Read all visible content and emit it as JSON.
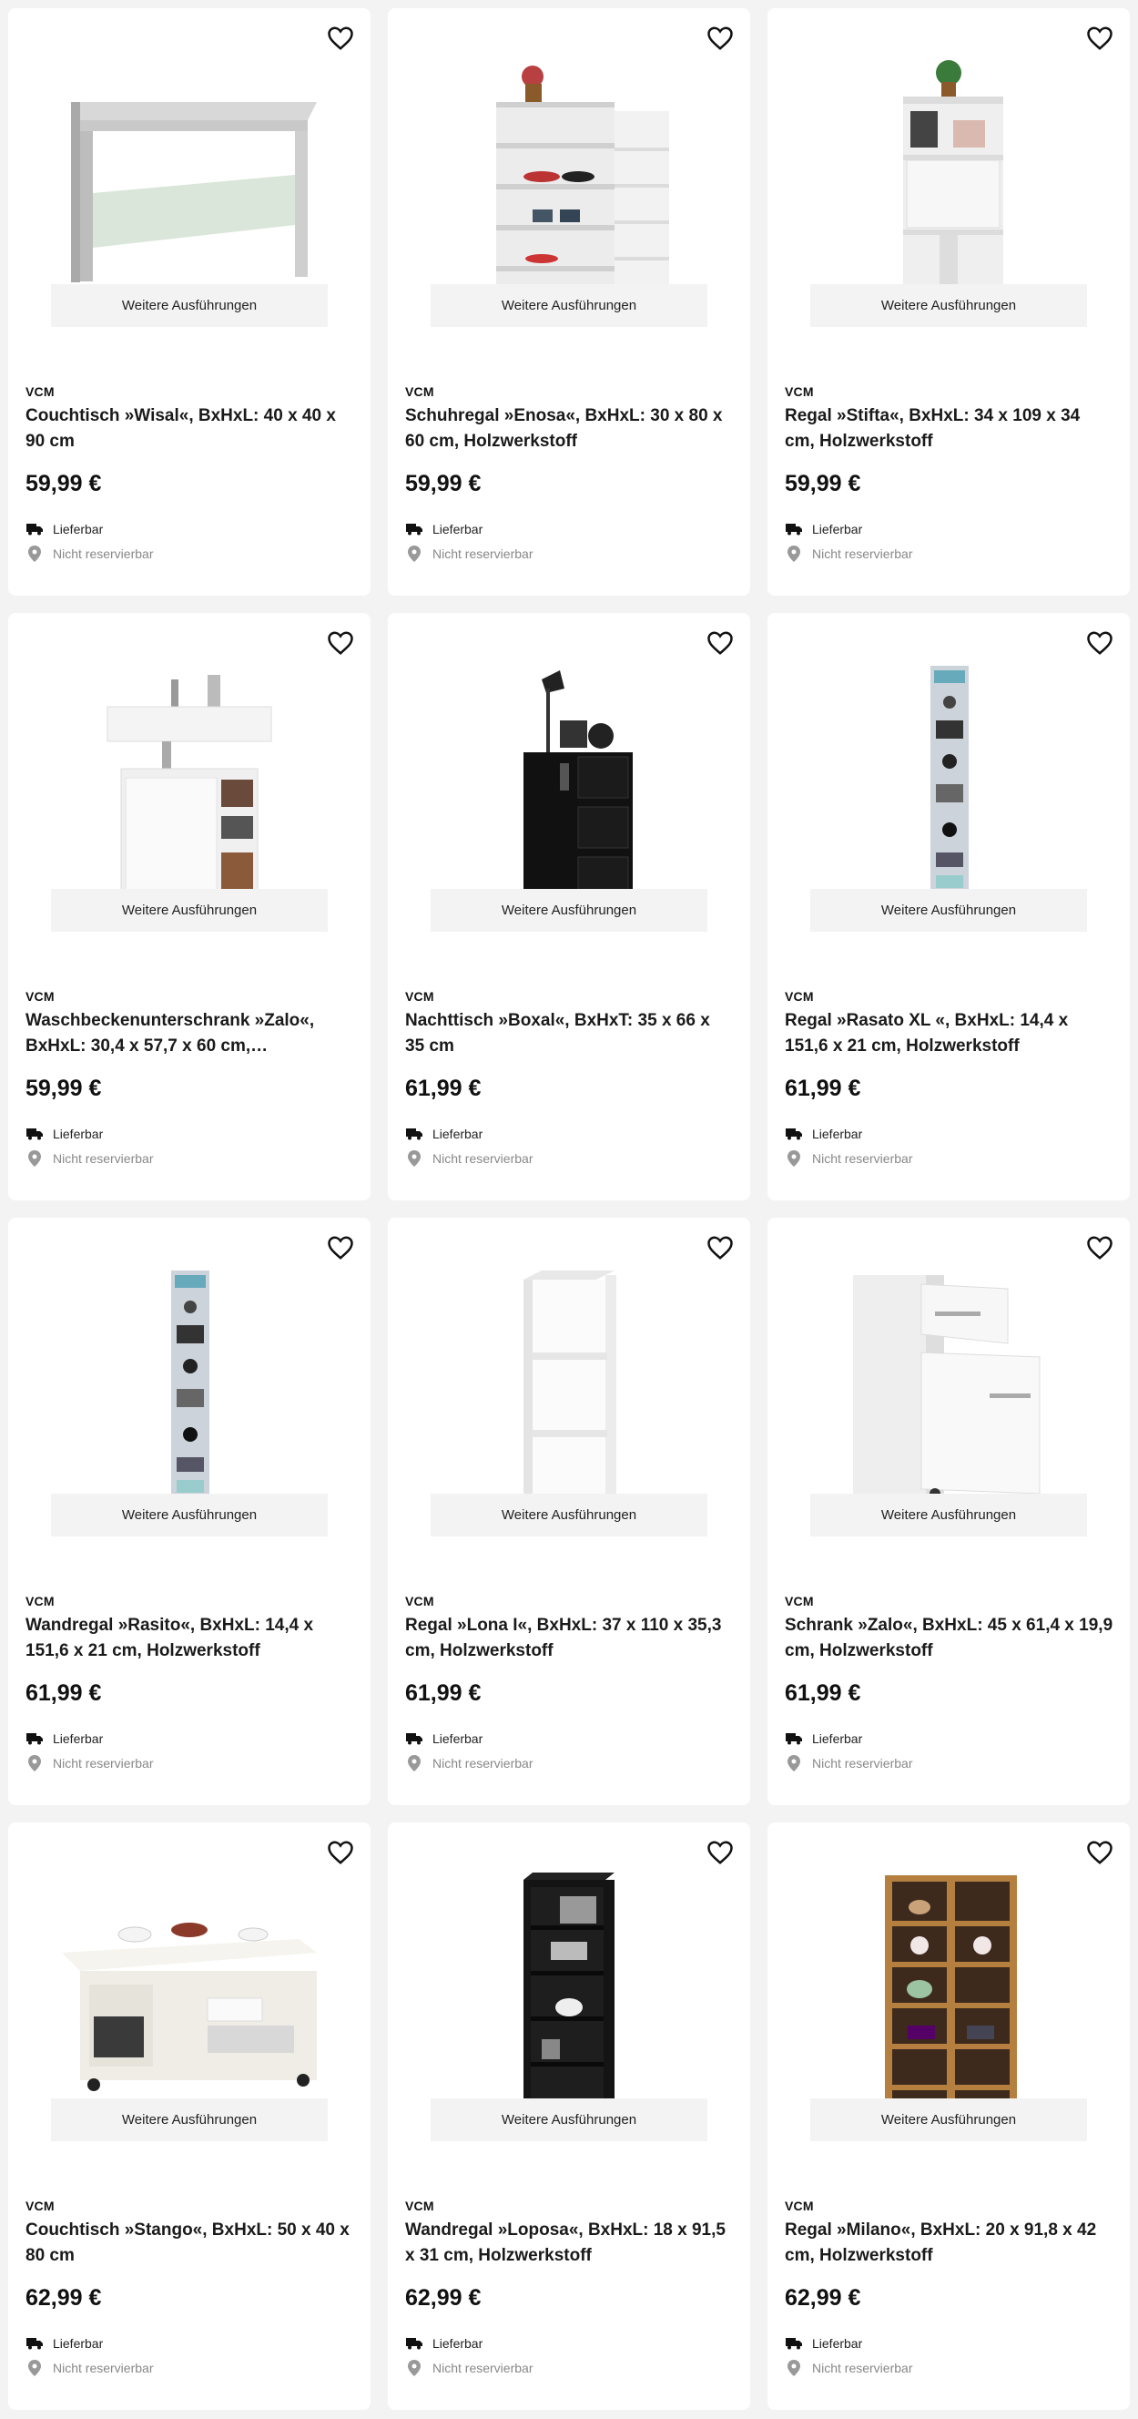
{
  "ui": {
    "more_label": "Weitere Ausführungen",
    "delivery_label": "Lieferbar",
    "reserve_label": "Nicht reservierbar",
    "favorite_icon": "heart-outline-icon",
    "delivery_icon": "truck-icon",
    "reserve_icon": "location-pin-icon"
  },
  "products": [
    {
      "brand": "VCM",
      "title": "Couchtisch »Wisal«, BxHxL: 40 x 40 x 90 cm",
      "price": "59,99 €"
    },
    {
      "brand": "VCM",
      "title": "Schuhregal »Enosa«, BxHxL: 30 x 80 x 60 cm, Holzwerkstoff",
      "price": "59,99 €"
    },
    {
      "brand": "VCM",
      "title": "Regal »Stifta«, BxHxL: 34 x 109 x 34 cm, Holzwerkstoff",
      "price": "59,99 €"
    },
    {
      "brand": "VCM",
      "title": "Waschbeckenunterschrank »Zalo«, BxHxL: 30,4 x 57,7 x 60 cm,…",
      "price": "59,99 €"
    },
    {
      "brand": "VCM",
      "title": "Nachttisch »Boxal«, BxHxT: 35 x 66 x 35 cm",
      "price": "61,99 €"
    },
    {
      "brand": "VCM",
      "title": "Regal »Rasato XL «, BxHxL: 14,4 x 151,6 x 21 cm, Holzwerkstoff",
      "price": "61,99 €"
    },
    {
      "brand": "VCM",
      "title": "Wandregal »Rasito«, BxHxL: 14,4 x 151,6 x 21 cm, Holzwerkstoff",
      "price": "61,99 €"
    },
    {
      "brand": "VCM",
      "title": "Regal »Lona I«, BxHxL: 37 x 110 x 35,3 cm, Holzwerkstoff",
      "price": "61,99 €"
    },
    {
      "brand": "VCM",
      "title": "Schrank »Zalo«, BxHxL: 45 x 61,4 x 19,9 cm, Holzwerkstoff",
      "price": "61,99 €"
    },
    {
      "brand": "VCM",
      "title": "Couchtisch »Stango«, BxHxL: 50 x 40 x 80 cm",
      "price": "62,99 €"
    },
    {
      "brand": "VCM",
      "title": "Wandregal »Loposa«, BxHxL: 18 x 91,5 x 31 cm, Holzwerkstoff",
      "price": "62,99 €"
    },
    {
      "brand": "VCM",
      "title": "Regal »Milano«, BxHxL: 20 x 91,8 x 42 cm, Holzwerkstoff",
      "price": "62,99 €"
    }
  ]
}
